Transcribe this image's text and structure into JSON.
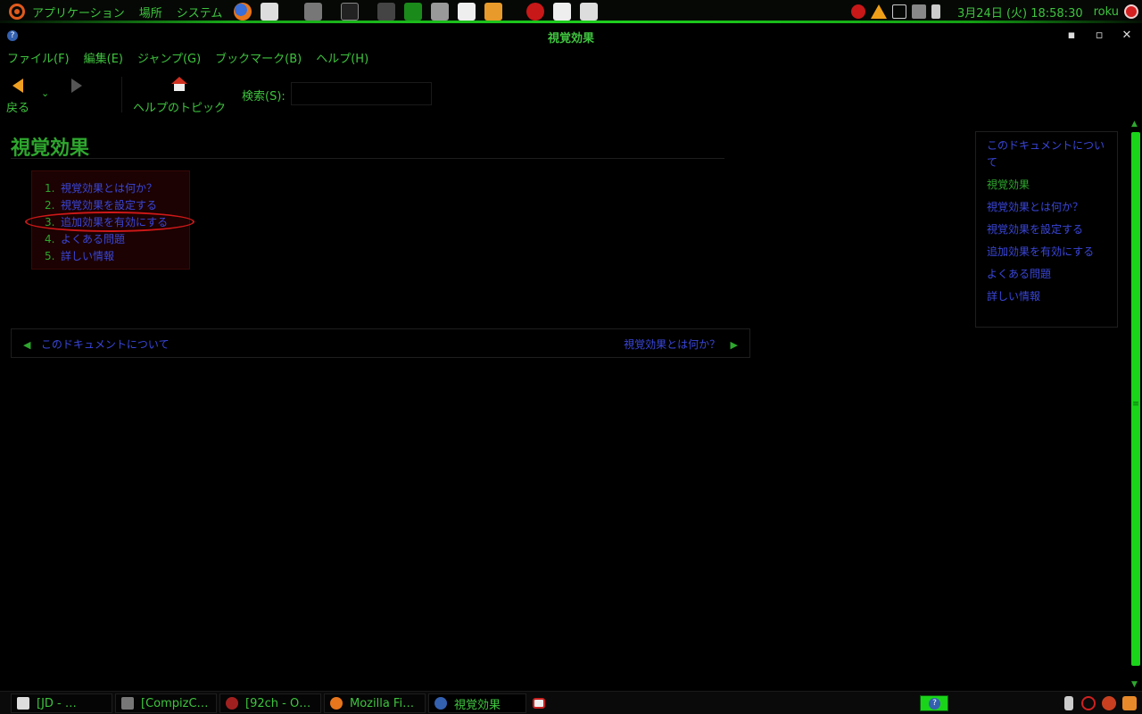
{
  "top_panel": {
    "menus": [
      "アプリケーション",
      "場所",
      "システム"
    ],
    "clock": "3月24日 (火) 18:58:30",
    "username": "roku"
  },
  "window": {
    "title": "視覚効果",
    "help_glyph": "?",
    "minimize_glyph": "▪",
    "maximize_glyph": "▫",
    "close_glyph": "✕"
  },
  "menubar": [
    "ファイル(F)",
    "編集(E)",
    "ジャンプ(G)",
    "ブックマーク(B)",
    "ヘルプ(H)"
  ],
  "toolbar": {
    "back_label": "戻る",
    "history_glyph": "⌄",
    "help_topics_label": "ヘルプのトピック",
    "search_label": "検索(S):",
    "search_value": ""
  },
  "page": {
    "title": "視覚効果",
    "toc": [
      {
        "num": "1.",
        "label": "視覚効果とは何か？"
      },
      {
        "num": "2.",
        "label": "視覚効果を設定する"
      },
      {
        "num": "3.",
        "label": "追加効果を有効にする"
      },
      {
        "num": "4.",
        "label": "よくある問題"
      },
      {
        "num": "5.",
        "label": "詳しい情報"
      }
    ],
    "nav_prev": "このドキュメントについて",
    "nav_next": "視覚効果とは何か？",
    "prev_glyph": "◀",
    "next_glyph": "▶"
  },
  "sidebar": {
    "items": [
      {
        "label": "このドキュメントについて",
        "current": false
      },
      {
        "label": "視覚効果",
        "current": true
      },
      {
        "label": "視覚効果とは何か？",
        "current": false
      },
      {
        "label": "視覚効果を設定する",
        "current": false
      },
      {
        "label": "追加効果を有効にする",
        "current": false
      },
      {
        "label": "よくある問題",
        "current": false
      },
      {
        "label": "詳しい情報",
        "current": false
      }
    ]
  },
  "scrollbar": {
    "up_glyph": "▲",
    "down_glyph": "▼",
    "grip_glyph": "≡"
  },
  "taskbar": {
    "tasks": [
      "[JD - …",
      "[CompizC…",
      "[92ch - O…",
      "Mozilla Fi…",
      "視覚効果"
    ],
    "pager_glyph": "?"
  },
  "colors": {
    "accent_green": "#3ec43e",
    "link_blue": "#3a46d8",
    "highlight_red": "#d01818",
    "toc_bg": "#1c0202"
  }
}
